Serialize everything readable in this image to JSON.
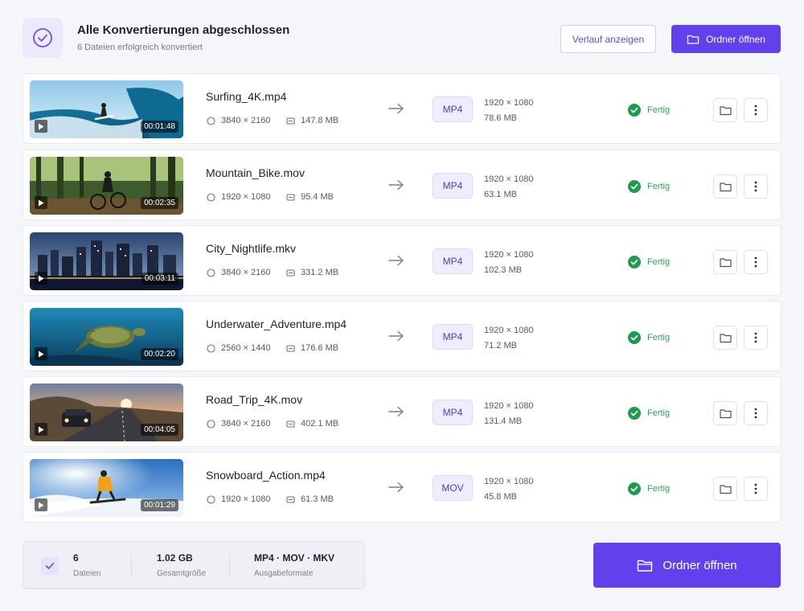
{
  "header": {
    "title": "Alle Konvertierungen abgeschlossen",
    "subtitle": "6 Dateien erfolgreich konvertiert",
    "history_button": "Verlauf anzeigen",
    "open_folder_button": "Ordner öffnen"
  },
  "files": [
    {
      "name": "Surfing_4K.mp4",
      "duration": "00:01:48",
      "src_res": "3840 × 2160",
      "src_size": "147.8 MB",
      "format": "MP4",
      "out_res": "1920 × 1080",
      "out_size": "78.6 MB",
      "status": "Fertig"
    },
    {
      "name": "Mountain_Bike.mov",
      "duration": "00:02:35",
      "src_res": "1920 × 1080",
      "src_size": "95.4 MB",
      "format": "MP4",
      "out_res": "1920 × 1080",
      "out_size": "63.1 MB",
      "status": "Fertig"
    },
    {
      "name": "City_Nightlife.mkv",
      "duration": "00:03:11",
      "src_res": "3840 × 2160",
      "src_size": "331.2 MB",
      "format": "MP4",
      "out_res": "1920 × 1080",
      "out_size": "102.3 MB",
      "status": "Fertig"
    },
    {
      "name": "Underwater_Adventure.mp4",
      "duration": "00:02:20",
      "src_res": "2560 × 1440",
      "src_size": "176.6 MB",
      "format": "MP4",
      "out_res": "1920 × 1080",
      "out_size": "71.2 MB",
      "status": "Fertig"
    },
    {
      "name": "Road_Trip_4K.mov",
      "duration": "00:04:05",
      "src_res": "3840 × 2160",
      "src_size": "402.1 MB",
      "format": "MP4",
      "out_res": "1920 × 1080",
      "out_size": "131.4 MB",
      "status": "Fertig"
    },
    {
      "name": "Snowboard_Action.mp4",
      "duration": "00:01:29",
      "src_res": "1920 × 1080",
      "src_size": "61.3 MB",
      "format": "MOV",
      "out_res": "1920 × 1080",
      "out_size": "45.8 MB",
      "status": "Fertig"
    }
  ],
  "summary": {
    "count_value": "6",
    "count_label": "Dateien",
    "size_value": "1.02 GB",
    "size_label": "Gesamtgröße",
    "formats_value": "MP4 · MOV · MKV",
    "formats_label": "Ausgabeformate"
  },
  "footer": {
    "open_folder_button": "Ordner öffnen"
  },
  "icons": {
    "header_badge": "check-circle-icon",
    "play": "play-icon",
    "resolution": "circle-icon",
    "size": "drive-icon",
    "arrow": "arrow-right-icon",
    "status": "check-circle-icon",
    "folder": "folder-icon",
    "more": "more-vertical-icon"
  },
  "colors": {
    "accent": "#6241ec",
    "success": "#2f9d57",
    "format_badge_bg": "#efedfd"
  }
}
